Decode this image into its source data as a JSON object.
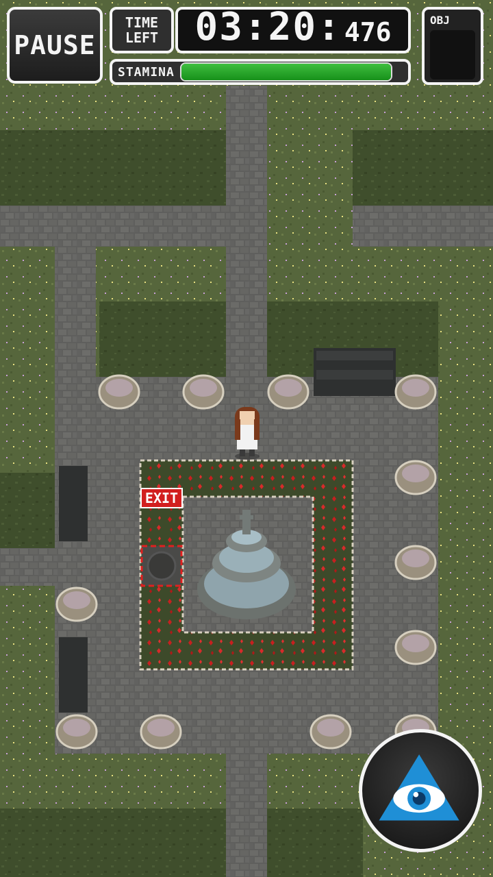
{
  "hud": {
    "pause_label": "PAUSE",
    "time_label_line1": "TIME",
    "time_label_line2": "LEFT",
    "timer_main": "03:20:",
    "timer_ms": "476",
    "stamina_label": "STAMINA",
    "stamina_level": 1.0,
    "obj_label": "OBJ"
  },
  "map": {
    "exit_label": "EXIT"
  },
  "colors": {
    "stamina": "#2aa82a",
    "exit": "#d21f1f",
    "eye": "#1f8fd6"
  },
  "icons": {
    "eye_button": "all-seeing-eye-icon"
  }
}
